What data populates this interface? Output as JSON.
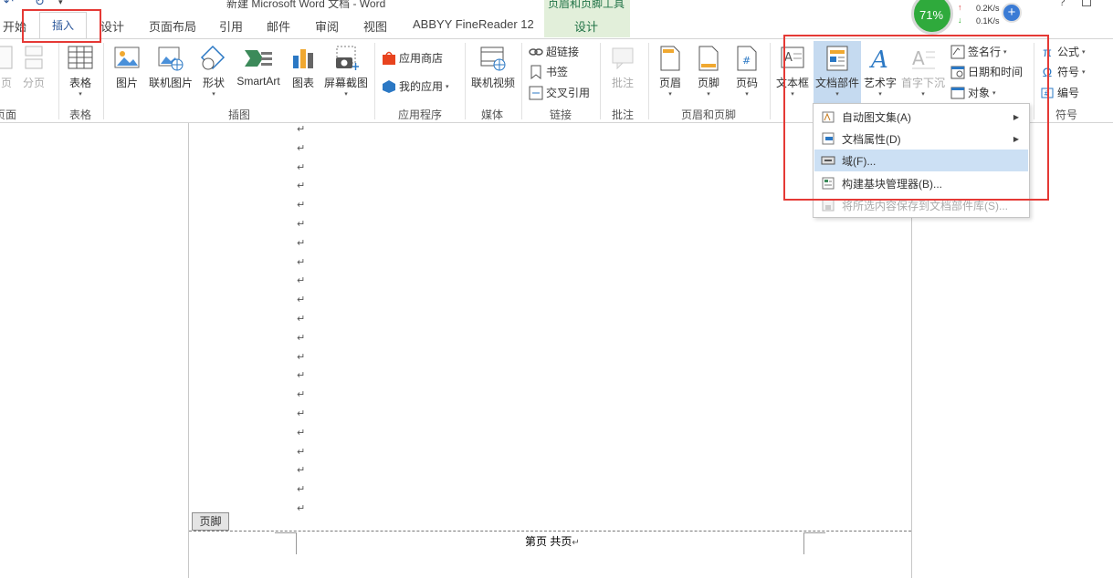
{
  "title_bar": {
    "title": "新建 Microsoft Word 文档 - Word"
  },
  "context_group": {
    "title": "页眉和页脚工具",
    "tab": "设计"
  },
  "tabs": [
    "开始",
    "插入",
    "设计",
    "页面布局",
    "引用",
    "邮件",
    "审阅",
    "视图",
    "ABBYY FineReader 12"
  ],
  "ribbon": {
    "pages_group": {
      "page": "页",
      "page_break": "分页",
      "label": "页面"
    },
    "table": {
      "button": "表格",
      "label": "表格"
    },
    "illustrations": {
      "buttons": [
        "图片",
        "联机图片",
        "形状",
        "SmartArt",
        "图表",
        "屏幕截图"
      ],
      "label": "插图"
    },
    "apps": {
      "store": "应用商店",
      "my_apps": "我的应用",
      "label": "应用程序"
    },
    "media": {
      "online_video": "联机视频",
      "label": "媒体"
    },
    "links": {
      "hyperlink": "超链接",
      "bookmark": "书签",
      "cross_ref": "交叉引用",
      "label": "链接"
    },
    "comments": {
      "comment": "批注",
      "label": "批注"
    },
    "header_footer": {
      "header": "页眉",
      "footer": "页脚",
      "page_number": "页码",
      "label": "页眉和页脚"
    },
    "text": {
      "textbox": "文本框",
      "quick_parts": "文档部件",
      "wordart": "艺术字",
      "dropcap": "首字下沉",
      "signature": "签名行",
      "datetime": "日期和时间",
      "object": "对象"
    },
    "symbols": {
      "equation": "公式",
      "symbol": "符号",
      "number": "编号",
      "label": "符号"
    }
  },
  "quick_parts_menu": {
    "items": [
      {
        "label": "自动图文集(A)",
        "submenu": true,
        "enabled": true
      },
      {
        "label": "文档属性(D)",
        "submenu": true,
        "enabled": true
      },
      {
        "label": "域(F)...",
        "submenu": false,
        "enabled": true,
        "highlighted": true
      },
      {
        "label": "构建基块管理器(B)...",
        "submenu": false,
        "enabled": true
      },
      {
        "label": "将所选内容保存到文档部件库(S)...",
        "submenu": false,
        "enabled": false
      }
    ]
  },
  "speed_widget": {
    "percent": "71%",
    "up": "0.2K/s",
    "down": "0.1K/s"
  },
  "document": {
    "footer_tag": "页脚",
    "footer_text": "第页 共页",
    "paragraph_mark": "↵",
    "paragraph_count": 21
  },
  "colors": {
    "accent": "#2b579a",
    "context_green": "#e2efda",
    "highlight_box": "#e53935",
    "menu_hover": "#cce0f4"
  }
}
